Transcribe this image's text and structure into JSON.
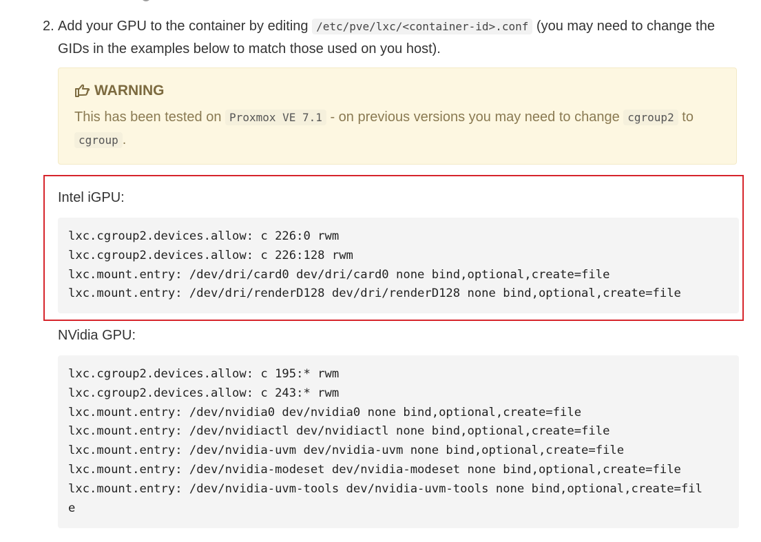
{
  "step": {
    "number": "2.",
    "text_before": "Add your GPU to the container by editing ",
    "path_code": "/etc/pve/lxc/<container-id>.conf",
    "text_after": " (you may need to change the GIDs in the examples below to match those used on you host)."
  },
  "warning": {
    "title": "WARNING",
    "icon": "hand-pointing-icon",
    "text_1": "This has been tested on ",
    "code_1": "Proxmox VE 7.1",
    "text_2": " - on previous versions you may need to change ",
    "code_2": "cgroup2",
    "text_3": " to ",
    "code_3": "cgroup",
    "text_4": "."
  },
  "intel": {
    "label": "Intel iGPU:",
    "lines": [
      "lxc.cgroup2.devices.allow: c 226:0 rwm",
      "lxc.cgroup2.devices.allow: c 226:128 rwm",
      "lxc.mount.entry: /dev/dri/card0 dev/dri/card0 none bind,optional,create=file",
      "lxc.mount.entry: /dev/dri/renderD128 dev/dri/renderD128 none bind,optional,create=file"
    ]
  },
  "nvidia": {
    "label": "NVidia GPU:",
    "lines": [
      "lxc.cgroup2.devices.allow: c 195:* rwm",
      "lxc.cgroup2.devices.allow: c 243:* rwm",
      "lxc.mount.entry: /dev/nvidia0 dev/nvidia0 none bind,optional,create=file",
      "lxc.mount.entry: /dev/nvidiactl dev/nvidiactl none bind,optional,create=file",
      "lxc.mount.entry: /dev/nvidia-uvm dev/nvidia-uvm none bind,optional,create=file",
      "lxc.mount.entry: /dev/nvidia-modeset dev/nvidia-modeset none bind,optional,create=file",
      "lxc.mount.entry: /dev/nvidia-uvm-tools dev/nvidia-uvm-tools none bind,optional,create=fil",
      "e"
    ]
  },
  "colors": {
    "highlight_border": "#d6242b",
    "warning_bg": "#fdf7e1",
    "warning_text": "#8a7a52"
  }
}
